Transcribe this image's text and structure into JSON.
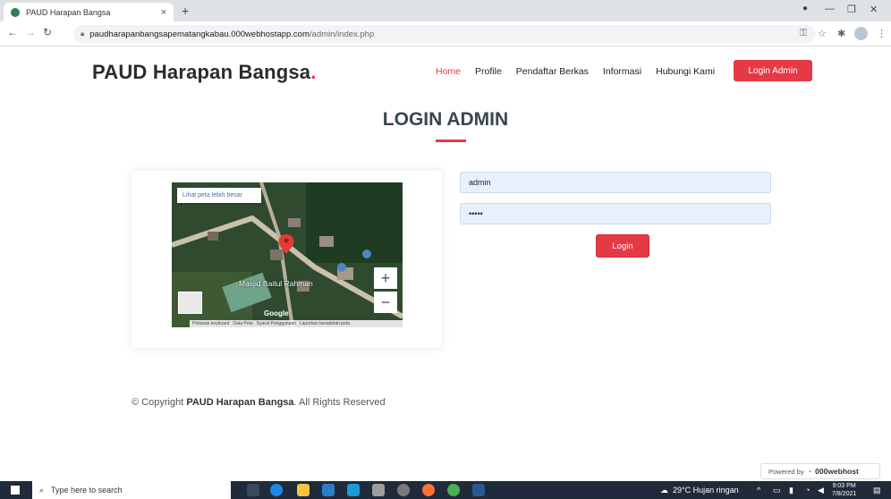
{
  "browser": {
    "tab_title": "PAUD Harapan Bangsa",
    "tab_close": "×",
    "new_tab": "+",
    "url_host": "paudharapanbangsapematangkabau.000webhostapp.com",
    "url_path": "/admin/index.php",
    "icons": [
      "back-icon",
      "forward-icon",
      "reload-icon",
      "lock-icon",
      "key-icon",
      "star-icon",
      "extensions-icon",
      "menu-icon"
    ]
  },
  "header": {
    "brand": "PAUD Harapan Bangsa",
    "brand_dot": ".",
    "nav": {
      "home": "Home",
      "profile": "Profile",
      "pendaftar": "Pendaftar Berkas",
      "informasi": "Informasi",
      "hubungi": "Hubungi Kami"
    },
    "login_button": "Login Admin",
    "accent_color": "#e63946"
  },
  "section": {
    "title": "LOGIN ADMIN"
  },
  "map": {
    "view_larger": "Lihat peta lebih besar",
    "place_label": "Masjid Baitul Rahman",
    "zoom_in": "+",
    "zoom_out": "−",
    "footer": {
      "keyboard": "Pintasan keyboard",
      "data": "Data Peta",
      "terms": "Syarat Penggunaan",
      "report": "Laporkan kesalahan peta"
    },
    "logo": "Google"
  },
  "form": {
    "username_value": "admin",
    "password_value": "•••••",
    "login_button": "Login"
  },
  "footer": {
    "copyright_prefix": "© Copyright",
    "copyright_brand": "PAUD Harapan Bangsa",
    "copyright_suffix": ". All Rights Reserved",
    "powered_by": "Powered by",
    "powered_brand": "000webhost"
  },
  "taskbar": {
    "search_placeholder": "Type here to search",
    "weather": "29°C  Hujan ringan",
    "time": "9:03 PM",
    "date": "7/8/2021"
  }
}
